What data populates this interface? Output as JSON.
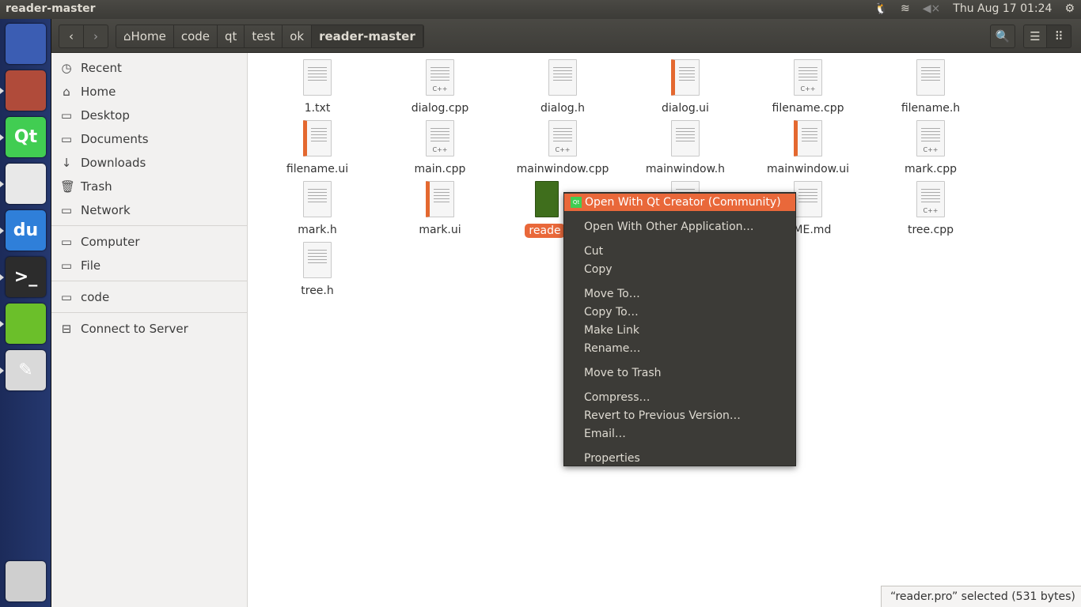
{
  "window_title": "reader-master",
  "tray": {
    "datetime": "Thu Aug 17 01:24",
    "icons": [
      "tux-icon",
      "wifi-icon",
      "volume-muted-icon",
      "power-gear-icon"
    ]
  },
  "launcher": [
    {
      "name": "ubuntu-dash",
      "label": "",
      "color": "#3b5db3"
    },
    {
      "name": "files",
      "label": "",
      "color": "#b04b3a"
    },
    {
      "name": "qt-creator",
      "label": "Qt",
      "color": "#41cd52"
    },
    {
      "name": "chrome",
      "label": "",
      "color": "#e8e8e8"
    },
    {
      "name": "baidu-music",
      "label": "du",
      "color": "#2f7fd9"
    },
    {
      "name": "terminal",
      "label": ">_",
      "color": "#2c2c2c"
    },
    {
      "name": "qt-tool",
      "label": "",
      "color": "#6bbf2a"
    },
    {
      "name": "text-editor",
      "label": "✎",
      "color": "#d9d9d9"
    },
    {
      "name": "trash",
      "label": "",
      "color": "#cfcfcf"
    }
  ],
  "toolbar": {
    "breadcrumb": [
      "Home",
      "code",
      "qt",
      "test",
      "ok",
      "reader-master"
    ]
  },
  "sidebar": {
    "items": [
      {
        "label": "Recent",
        "icon": "clock-icon",
        "glyph": "◷"
      },
      {
        "label": "Home",
        "icon": "home-icon",
        "glyph": "⌂"
      },
      {
        "label": "Desktop",
        "icon": "folder-icon",
        "glyph": "▭"
      },
      {
        "label": "Documents",
        "icon": "folder-icon",
        "glyph": "▭"
      },
      {
        "label": "Downloads",
        "icon": "download-icon",
        "glyph": "↓"
      },
      {
        "label": "Trash",
        "icon": "trash-icon",
        "glyph": "🗑"
      },
      {
        "label": "Network",
        "icon": "network-icon",
        "glyph": "▭"
      },
      {
        "label": "Computer",
        "icon": "computer-icon",
        "glyph": "▭"
      },
      {
        "label": "File",
        "icon": "drive-icon",
        "glyph": "▭"
      },
      {
        "label": "code",
        "icon": "folder-icon",
        "glyph": "▭"
      },
      {
        "label": "Connect to Server",
        "icon": "server-icon",
        "glyph": "⊟"
      }
    ]
  },
  "files": [
    {
      "name": "1.txt",
      "type": "txt"
    },
    {
      "name": "dialog.cpp",
      "type": "cpp"
    },
    {
      "name": "dialog.h",
      "type": "h"
    },
    {
      "name": "dialog.ui",
      "type": "ui"
    },
    {
      "name": "filename.cpp",
      "type": "cpp"
    },
    {
      "name": "filename.h",
      "type": "h"
    },
    {
      "name": "filename.ui",
      "type": "ui"
    },
    {
      "name": "main.cpp",
      "type": "cpp"
    },
    {
      "name": "mainwindow.cpp",
      "type": "cpp"
    },
    {
      "name": "mainwindow.h",
      "type": "h"
    },
    {
      "name": "mainwindow.ui",
      "type": "ui"
    },
    {
      "name": "mark.cpp",
      "type": "cpp"
    },
    {
      "name": "mark.h",
      "type": "h"
    },
    {
      "name": "mark.ui",
      "type": "ui"
    },
    {
      "name": "reade",
      "type": "qt",
      "selected": true
    },
    {
      "name": "",
      "type": "txt"
    },
    {
      "name": "DME.md",
      "type": "txt"
    },
    {
      "name": "tree.cpp",
      "type": "cpp"
    },
    {
      "name": "tree.h",
      "type": "h"
    }
  ],
  "context_menu": {
    "items": [
      {
        "label": "Open With Qt Creator (Community)",
        "highlighted": true
      },
      {
        "label": "Open With Other Application…"
      },
      {
        "label": "Cut"
      },
      {
        "label": "Copy"
      },
      {
        "label": "Move To…"
      },
      {
        "label": "Copy To…"
      },
      {
        "label": "Make Link"
      },
      {
        "label": "Rename…"
      },
      {
        "label": "Move to Trash"
      },
      {
        "label": "Compress…"
      },
      {
        "label": "Revert to Previous Version…"
      },
      {
        "label": "Email…"
      },
      {
        "label": "Properties"
      }
    ]
  },
  "status": "“reader.pro” selected  (531 bytes)",
  "colors": {
    "accent": "#e9683a",
    "panel": "#3c3b37",
    "launcher": "#25386f"
  }
}
